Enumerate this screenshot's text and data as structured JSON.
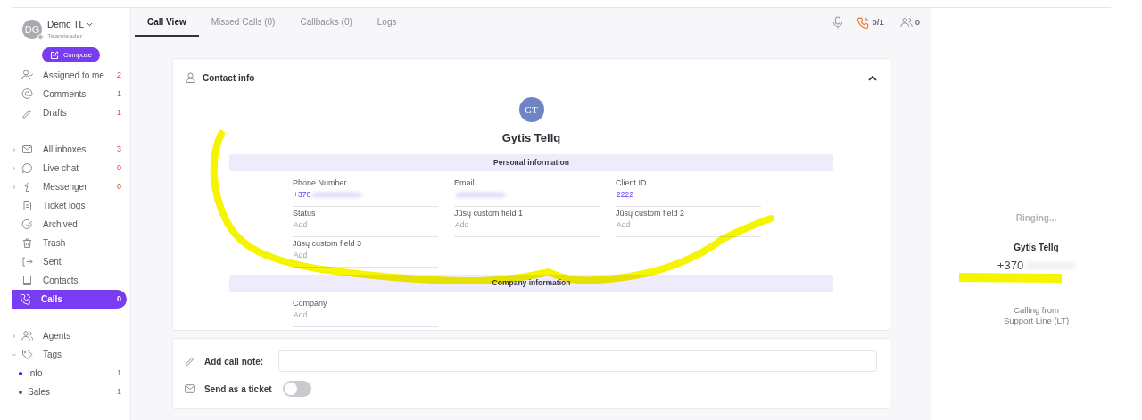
{
  "user": {
    "initials": "DG",
    "name": "Demo TL",
    "role": "Teamleader",
    "online": true
  },
  "compose_button": "Compose",
  "sidebar": {
    "groups": [
      {
        "items": [
          {
            "label": "Assigned to me",
            "count": "2",
            "selected": false
          },
          {
            "label": "Comments",
            "count": "1",
            "selected": false
          },
          {
            "label": "Drafts",
            "count": "1",
            "selected": false
          }
        ]
      },
      {
        "items": [
          {
            "label": "All inboxes",
            "count": "3",
            "selected": false,
            "expanded": false
          },
          {
            "label": "Live chat",
            "count": "0",
            "selected": false,
            "expanded": false
          },
          {
            "label": "Messenger",
            "count": "0",
            "selected": false,
            "expanded": false
          },
          {
            "label": "Ticket logs",
            "selected": false
          },
          {
            "label": "Archived",
            "selected": false
          },
          {
            "label": "Trash",
            "selected": false
          },
          {
            "label": "Sent",
            "selected": false
          },
          {
            "label": "Contacts",
            "selected": false
          },
          {
            "label": "Calls",
            "count": "0",
            "selected": true
          }
        ]
      },
      {
        "items": [
          {
            "label": "Agents",
            "selected": false,
            "expanded": false
          },
          {
            "label": "Tags",
            "selected": false,
            "expanded": true,
            "children": [
              {
                "label": "Info",
                "count": "1",
                "color": "#1a1adc",
                "selected": false
              },
              {
                "label": "Sales",
                "count": "1",
                "color": "#138a13",
                "selected": false
              }
            ]
          }
        ]
      }
    ]
  },
  "tabs": [
    {
      "label": "Call View",
      "selected": true
    },
    {
      "label": "Missed Calls (0)",
      "selected": false
    },
    {
      "label": "Callbacks (0)",
      "selected": false
    },
    {
      "label": "Logs",
      "selected": false
    }
  ],
  "toolbar": {
    "calls": "0/1",
    "agents": "0"
  },
  "contact_card": {
    "title": "Contact info",
    "expanded": true,
    "avatar_initials": "GT",
    "name": "Gytis Tellq",
    "sections": [
      {
        "title": "Personal information",
        "fields": [
          {
            "label": "Phone Number",
            "value": "+370",
            "redacted": true
          },
          {
            "label": "Email",
            "redacted": true
          },
          {
            "label": "Client ID",
            "value": "2222"
          },
          {
            "label": "Status",
            "placeholder": "Add"
          },
          {
            "label": "Jūsų custom field 1",
            "placeholder": "Add"
          },
          {
            "label": "Jūsų custom field 2",
            "placeholder": "Add"
          },
          {
            "label": "Jūsų custom field 3",
            "placeholder": "Add"
          }
        ]
      },
      {
        "title": "Company information",
        "fields": [
          {
            "label": "Company",
            "placeholder": "Add"
          }
        ]
      }
    ],
    "highlighted": true
  },
  "note_card": {
    "note_label": "Add call note:",
    "ticket_label": "Send as a ticket",
    "send_as_ticket": false
  },
  "call_panel": {
    "status": "Ringing...",
    "caller": "Gytis Tellq",
    "number": "+370",
    "number_redacted": true,
    "highlighted": true,
    "calling_from": "Calling from",
    "line": "Support Line (LT)"
  }
}
